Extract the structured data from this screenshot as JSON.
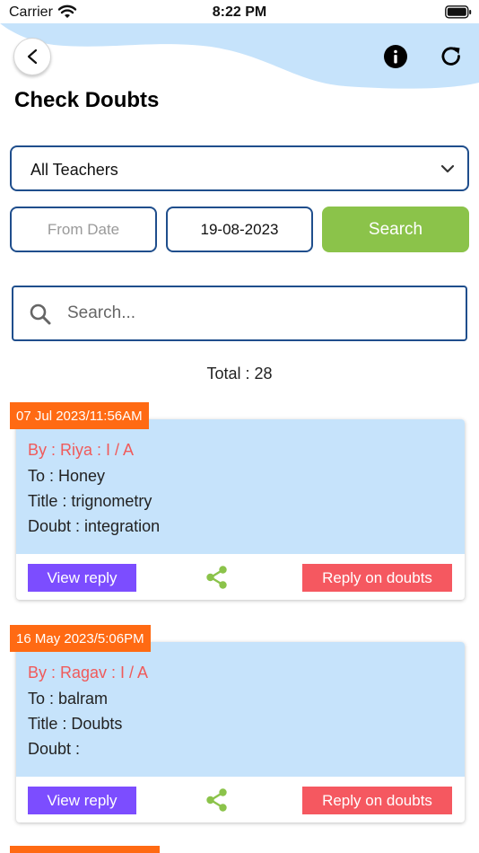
{
  "status_bar": {
    "carrier": "Carrier",
    "time": "8:22 PM"
  },
  "header": {
    "title": "Check Doubts",
    "back_label": "<"
  },
  "filters": {
    "teacher_selected": "All Teachers",
    "from_date_placeholder": "From Date",
    "to_date": "19-08-2023",
    "search_button": "Search"
  },
  "search": {
    "placeholder": "Search..."
  },
  "total": "Total : 28",
  "doubts": [
    {
      "date": "07 Jul 2023/11:56AM",
      "by": "By : Riya : I / A",
      "to": "To : Honey",
      "title": "Title : trignometry",
      "doubt": "Doubt : integration",
      "view_reply": "View reply",
      "reply": "Reply on doubts"
    },
    {
      "date": "16 May 2023/5:06PM",
      "by": "By : Ragav : I / A",
      "to": "To : balram",
      "title": "Title : Doubts",
      "doubt": "Doubt :",
      "view_reply": "View reply",
      "reply": "Reply on doubts"
    }
  ],
  "icons": {
    "back": "back-icon",
    "info": "info-icon",
    "refresh": "refresh-icon",
    "search": "search-icon",
    "dropdown": "chevron-down-icon",
    "share": "share-icon"
  },
  "colors": {
    "wave": "#c6e3fb",
    "border": "#1f4e8c",
    "search_button": "#8bc34a",
    "date_tag": "#ff6a13",
    "card_body": "#c6e3fb",
    "by_text": "#f05a5a",
    "view_reply": "#7c4dff",
    "reply": "#f55860",
    "share": "#8bc34a"
  }
}
